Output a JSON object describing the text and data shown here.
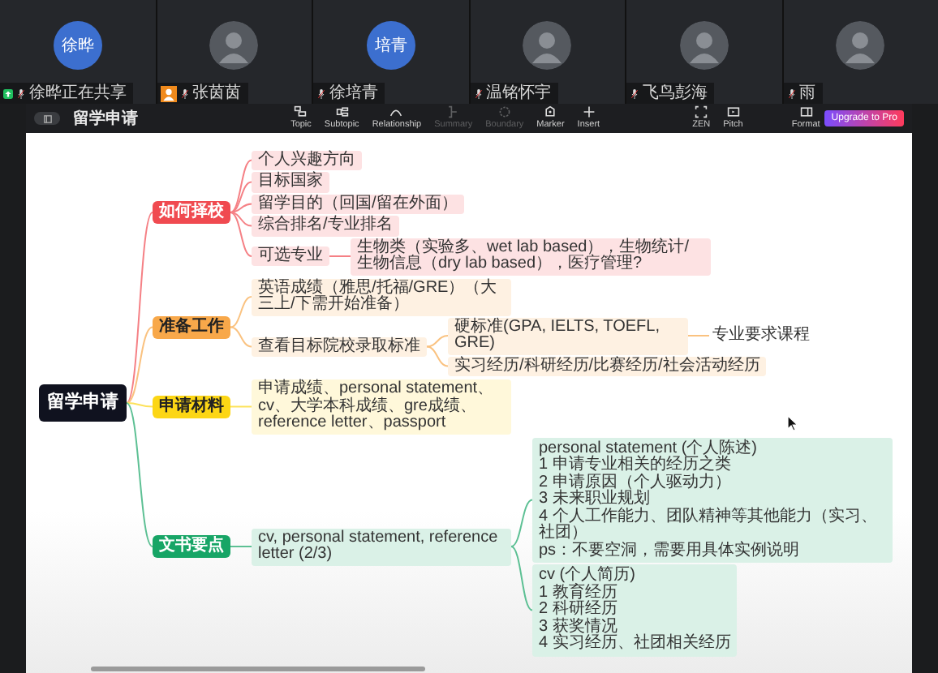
{
  "participants": [
    {
      "name": "徐晔正在共享",
      "avatar": {
        "kind": "initials",
        "text": "徐晔"
      },
      "host": false,
      "sharing": true
    },
    {
      "name": "张茵茵",
      "avatar": {
        "kind": "photo"
      },
      "host": true,
      "sharing": false
    },
    {
      "name": "徐培青",
      "avatar": {
        "kind": "initials",
        "text": "培青"
      },
      "host": false,
      "sharing": false
    },
    {
      "name": "温铭怀宇",
      "avatar": {
        "kind": "photo"
      },
      "host": false,
      "sharing": false
    },
    {
      "name": "飞鸟彭海",
      "avatar": {
        "kind": "photo"
      },
      "host": false,
      "sharing": false
    },
    {
      "name": "雨",
      "avatar": {
        "kind": "photo"
      },
      "host": false,
      "sharing": false
    }
  ],
  "shared_screen": {
    "toolbar": {
      "title": "留学申请",
      "tools": [
        {
          "label": "Topic",
          "disabled": false
        },
        {
          "label": "Subtopic",
          "disabled": false
        },
        {
          "label": "Relationship",
          "disabled": false
        },
        {
          "label": "Summary",
          "disabled": true
        },
        {
          "label": "Boundary",
          "disabled": true
        },
        {
          "label": "Marker",
          "disabled": false
        },
        {
          "label": "Insert",
          "disabled": false
        }
      ],
      "view_tools": [
        {
          "label": "ZEN"
        },
        {
          "label": "Pitch"
        }
      ],
      "format": "Format",
      "upgrade": "Upgrade to Pro"
    },
    "mindmap": {
      "root": "留学申请",
      "branches": [
        {
          "label": "如何择校",
          "color": "#f04a50",
          "children": [
            {
              "label": "个人兴趣方向"
            },
            {
              "label": "目标国家"
            },
            {
              "label": "留学目的（回国/留在外面）"
            },
            {
              "label": "综合排名/专业排名"
            },
            {
              "label": "可选专业",
              "children": [
                {
                  "label": "生物类（实验多、wet lab based），生物统计/生物信息（dry lab based），医疗管理?"
                }
              ]
            }
          ]
        },
        {
          "label": "准备工作",
          "color": "#f8a84a",
          "children": [
            {
              "label": "英语成绩（雅思/托福/GRE）（大三上/下需开始准备）"
            },
            {
              "label": "查看目标院校录取标准",
              "children": [
                {
                  "label": "硬标准(GPA, IELTS, TOEFL, GRE)",
                  "children": [
                    {
                      "label": "专业要求课程"
                    }
                  ]
                },
                {
                  "label": "实习经历/科研经历/比赛经历/社会活动经历"
                }
              ]
            }
          ]
        },
        {
          "label": "申请材料",
          "color": "#fcd615",
          "children": [
            {
              "label": "申请成绩、personal statement、cv、大学本科成绩、gre成绩、reference letter、passport"
            }
          ]
        },
        {
          "label": "文书要点",
          "color": "#17a566",
          "children": [
            {
              "label": "cv, personal statement, reference letter (2/3)",
              "children": [
                {
                  "lines": [
                    "personal statement (个人陈述)",
                    "1 申请专业相关的经历之类",
                    "2 申请原因（个人驱动力）",
                    "3 未来职业规划",
                    "4 个人工作能力、团队精神等其他能力（实习、社团）",
                    "ps：不要空洞，需要用具体实例说明"
                  ]
                },
                {
                  "lines": [
                    "cv (个人简历)",
                    "1 教育经历",
                    "2 科研经历",
                    "3 获奖情况",
                    "4 实习经历、社团相关经历"
                  ]
                }
              ]
            }
          ]
        }
      ]
    }
  }
}
